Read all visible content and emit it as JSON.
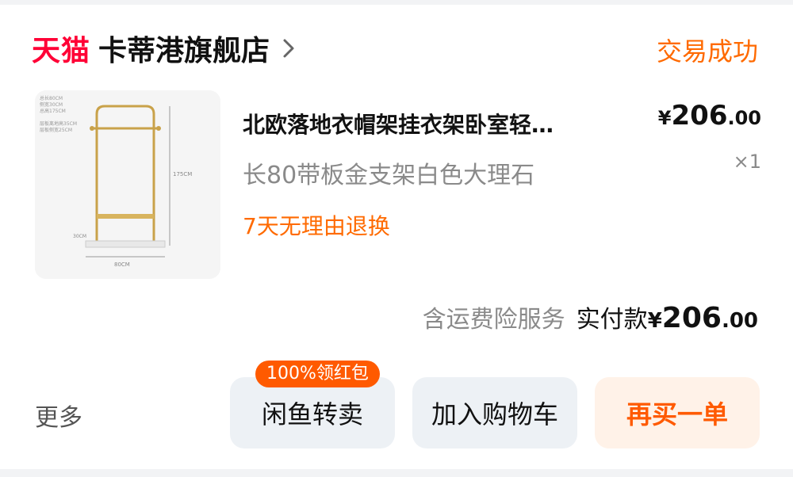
{
  "shop": {
    "platform": "天猫",
    "name": "卡蒂港旗舰店",
    "status": "交易成功"
  },
  "product": {
    "title": "北欧落地衣帽架挂衣架卧室轻…",
    "sku": "长80带板金支架白色大理石",
    "returns": "7天无理由退换",
    "price_currency": "¥",
    "price_int": "206",
    "price_dec": ".00",
    "quantity": "×1",
    "image_labels": {
      "spec_1": "总长80CM",
      "spec_2": "侧宽30CM",
      "spec_3": "总高175CM",
      "spec_4": "层板离地高35CM",
      "spec_5": "层板侧宽25CM",
      "height": "175CM",
      "width": "80CM",
      "depth": "30CM"
    }
  },
  "totals": {
    "service": "含运费险服务",
    "paid_label": "实付款",
    "paid_currency": "¥",
    "paid_int": "206",
    "paid_dec": ".00"
  },
  "actions": {
    "more": "更多",
    "xianyu": "闲鱼转卖",
    "xianyu_badge": "100%领红包",
    "add_cart": "加入购物车",
    "rebuy": "再买一单"
  },
  "colors": {
    "tmall_red": "#ff0036",
    "accent_orange": "#ff6a00",
    "button_bg": "#edf1f5",
    "rebuy_bg": "#fff2e8"
  }
}
